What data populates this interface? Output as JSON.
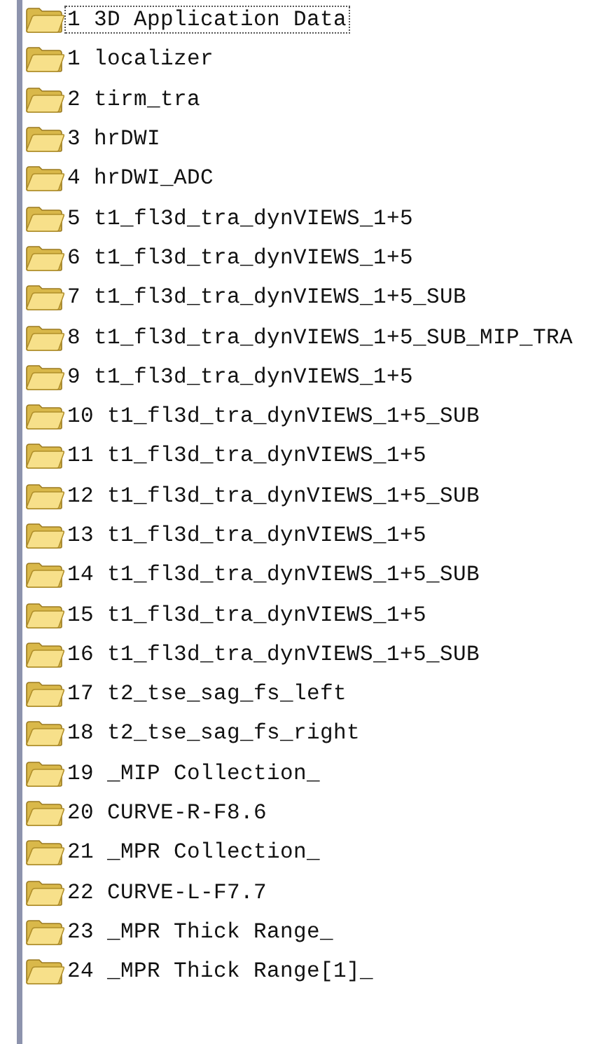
{
  "folders": [
    {
      "label": "1 3D Application Data",
      "focused": true
    },
    {
      "label": "1 localizer",
      "focused": false
    },
    {
      "label": "2 tirm_tra",
      "focused": false
    },
    {
      "label": "3 hrDWI",
      "focused": false
    },
    {
      "label": "4 hrDWI_ADC",
      "focused": false
    },
    {
      "label": "5 t1_fl3d_tra_dynVIEWS_1+5",
      "focused": false
    },
    {
      "label": "6 t1_fl3d_tra_dynVIEWS_1+5",
      "focused": false
    },
    {
      "label": "7 t1_fl3d_tra_dynVIEWS_1+5_SUB",
      "focused": false
    },
    {
      "label": "8 t1_fl3d_tra_dynVIEWS_1+5_SUB_MIP_TRA",
      "focused": false
    },
    {
      "label": "9 t1_fl3d_tra_dynVIEWS_1+5",
      "focused": false
    },
    {
      "label": "10 t1_fl3d_tra_dynVIEWS_1+5_SUB",
      "focused": false
    },
    {
      "label": "11 t1_fl3d_tra_dynVIEWS_1+5",
      "focused": false
    },
    {
      "label": "12 t1_fl3d_tra_dynVIEWS_1+5_SUB",
      "focused": false
    },
    {
      "label": "13 t1_fl3d_tra_dynVIEWS_1+5",
      "focused": false
    },
    {
      "label": "14 t1_fl3d_tra_dynVIEWS_1+5_SUB",
      "focused": false
    },
    {
      "label": "15 t1_fl3d_tra_dynVIEWS_1+5",
      "focused": false
    },
    {
      "label": "16 t1_fl3d_tra_dynVIEWS_1+5_SUB",
      "focused": false
    },
    {
      "label": "17 t2_tse_sag_fs_left",
      "focused": false
    },
    {
      "label": "18 t2_tse_sag_fs_right",
      "focused": false
    },
    {
      "label": "19 _MIP Collection_",
      "focused": false
    },
    {
      "label": "20 CURVE-R-F8.6",
      "focused": false
    },
    {
      "label": "21 _MPR Collection_",
      "focused": false
    },
    {
      "label": "22 CURVE-L-F7.7",
      "focused": false
    },
    {
      "label": "23 _MPR Thick Range_",
      "focused": false
    },
    {
      "label": "24 _MPR Thick Range[1]_",
      "focused": false
    }
  ]
}
